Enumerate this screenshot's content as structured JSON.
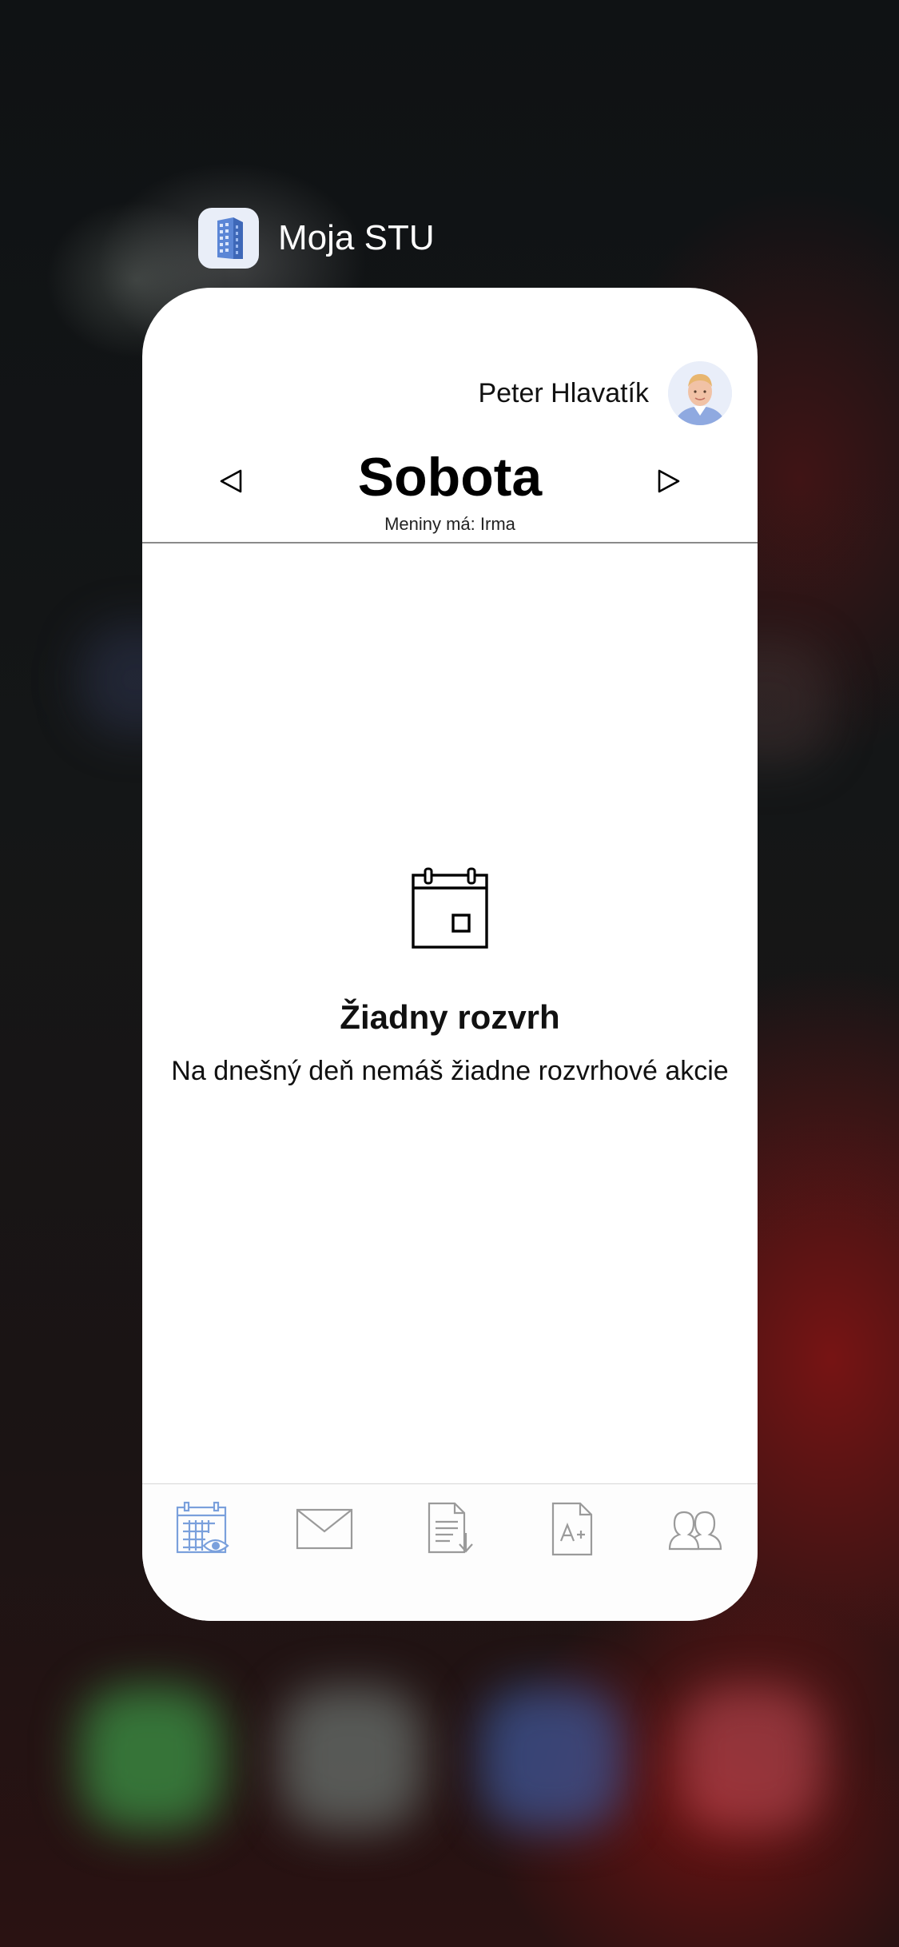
{
  "app_switcher": {
    "app_name": "Moja STU",
    "icon": "building-icon"
  },
  "header": {
    "user_name": "Peter Hlavatík",
    "avatar": "user-avatar"
  },
  "day": {
    "title": "Sobota",
    "nameday": "Meniny má: Irma",
    "prev_icon": "triangle-left-icon",
    "next_icon": "triangle-right-icon"
  },
  "empty_state": {
    "icon": "calendar-icon",
    "title": "Žiadny rozvrh",
    "message": "Na dnešný deň nemáš žiadne rozvrhové akcie"
  },
  "tabbar": {
    "active_color": "#7aa0dc",
    "inactive_color": "#9a9a9a",
    "tabs": [
      {
        "icon": "calendar-eye-icon",
        "active": true
      },
      {
        "icon": "envelope-icon",
        "active": false
      },
      {
        "icon": "document-download-icon",
        "active": false
      },
      {
        "icon": "grade-document-icon",
        "active": false
      },
      {
        "icon": "people-icon",
        "active": false
      }
    ]
  }
}
